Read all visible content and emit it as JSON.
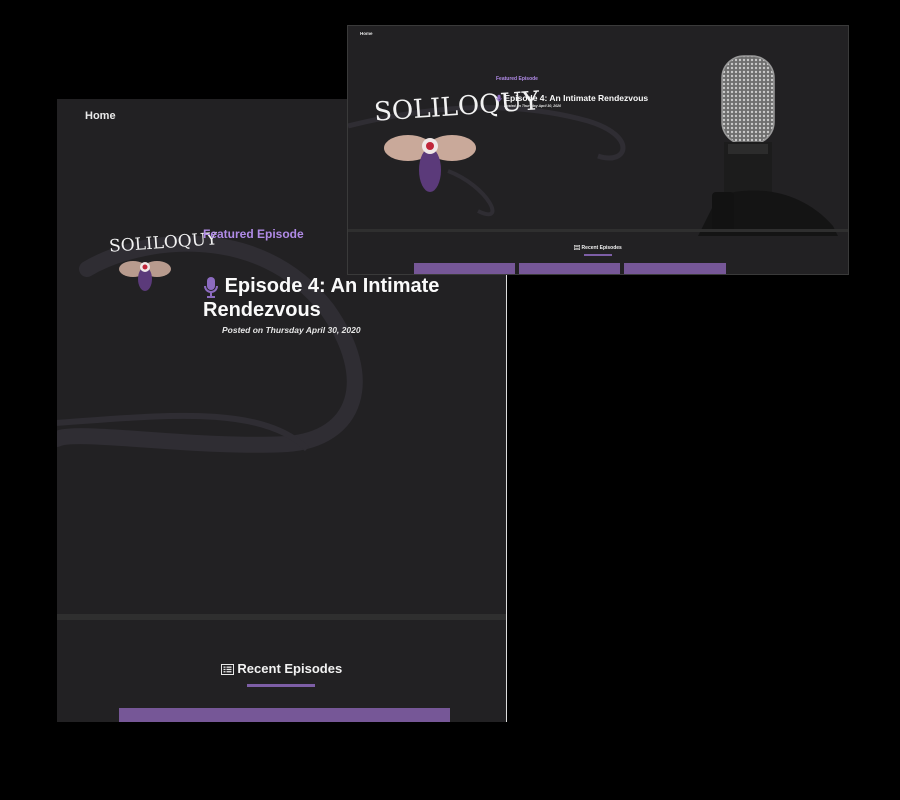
{
  "nav": {
    "home_label": "Home"
  },
  "logo": {
    "wordmark": "SOLILOQUY"
  },
  "featured": {
    "label": "Featured Episode",
    "episode_title": "Episode 4: An Intimate Rendezvous",
    "posted": "Posted on Thursday April 30, 2020"
  },
  "recent": {
    "heading": "Recent Episodes"
  },
  "colors": {
    "background": "#222123",
    "accent": "#b08ae6",
    "card": "#765797",
    "underline": "#7d5ea6"
  },
  "icons": {
    "episode": "microphone-icon",
    "recent": "list-icon"
  }
}
